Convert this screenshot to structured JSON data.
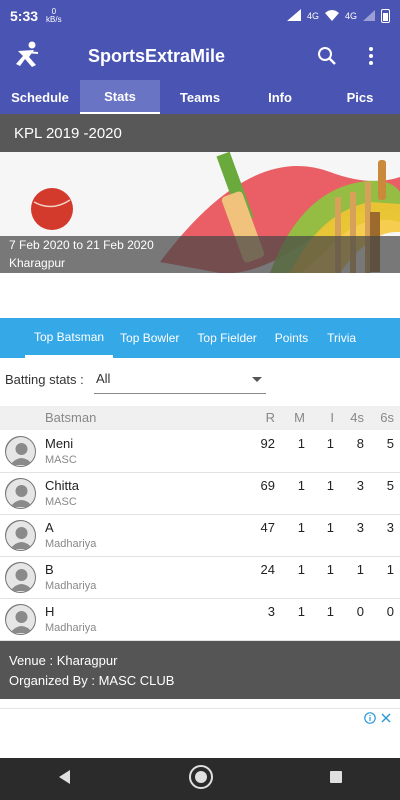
{
  "status": {
    "time": "5:33",
    "net_rate": "0",
    "net_unit": "kB/s",
    "signal_1": "4G",
    "signal_2": "4G"
  },
  "app": {
    "title": "SportsExtraMile"
  },
  "top_tabs": [
    {
      "label": "Schedule",
      "active": false
    },
    {
      "label": "Stats",
      "active": true
    },
    {
      "label": "Teams",
      "active": false
    },
    {
      "label": "Info",
      "active": false
    },
    {
      "label": "Pics",
      "active": false
    }
  ],
  "tournament": {
    "title": "KPL 2019 -2020",
    "dates": "7 Feb 2020 to 21 Feb 2020",
    "place": "Kharagpur"
  },
  "stat_tabs": [
    {
      "label": "Top Batsman",
      "active": true
    },
    {
      "label": "Top Bowler",
      "active": false
    },
    {
      "label": "Top Fielder",
      "active": false
    },
    {
      "label": "Points",
      "active": false
    },
    {
      "label": "Trivia",
      "active": false
    }
  ],
  "filter": {
    "label": "Batting stats :",
    "value": "All"
  },
  "table": {
    "headers": {
      "batsman": "Batsman",
      "r": "R",
      "m": "M",
      "i": "I",
      "fours": "4s",
      "sixes": "6s"
    },
    "rows": [
      {
        "name": "Meni",
        "team": "MASC",
        "r": "92",
        "m": "1",
        "i": "1",
        "fours": "8",
        "sixes": "5"
      },
      {
        "name": "Chitta",
        "team": "MASC",
        "r": "69",
        "m": "1",
        "i": "1",
        "fours": "3",
        "sixes": "5"
      },
      {
        "name": "A",
        "team": "Madhariya",
        "r": "47",
        "m": "1",
        "i": "1",
        "fours": "3",
        "sixes": "3"
      },
      {
        "name": "B",
        "team": "Madhariya",
        "r": "24",
        "m": "1",
        "i": "1",
        "fours": "1",
        "sixes": "1"
      },
      {
        "name": "H",
        "team": "Madhariya",
        "r": "3",
        "m": "1",
        "i": "1",
        "fours": "0",
        "sixes": "0"
      }
    ]
  },
  "footer": {
    "venue": "Venue : Kharagpur",
    "organizer": "Organized By : MASC CLUB"
  },
  "colors": {
    "primary": "#4a54b3",
    "tab_active": "#6a74c4",
    "accent": "#35a8e8",
    "dark_panel": "#555555"
  }
}
